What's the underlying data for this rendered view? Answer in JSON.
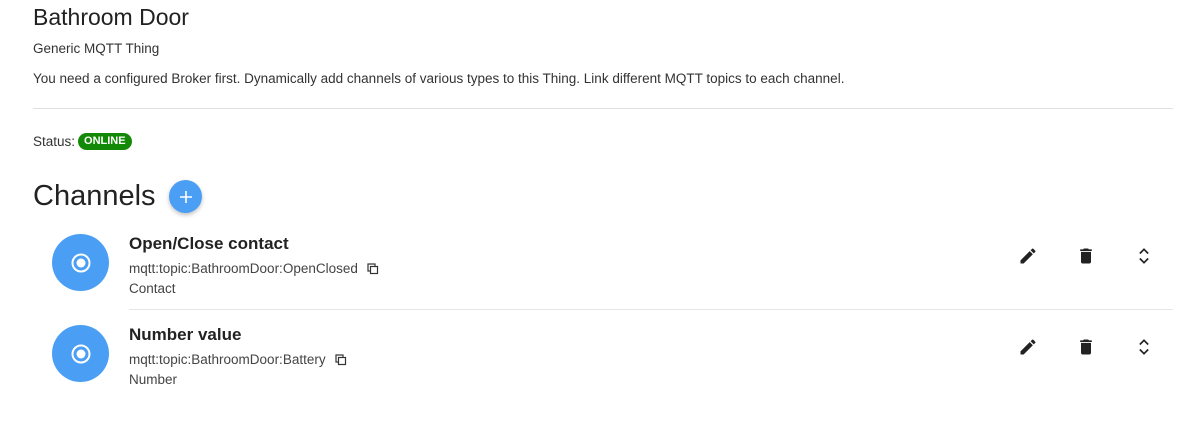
{
  "thing": {
    "title": "Bathroom Door",
    "type": "Generic MQTT Thing",
    "description": "You need a configured Broker first. Dynamically add channels of various types to this Thing. Link different MQTT topics to each channel."
  },
  "status": {
    "label": "Status:",
    "value": "ONLINE",
    "color": "#138a07"
  },
  "channels": {
    "title": "Channels",
    "add_icon": "plus-icon",
    "accent": "#4a9ff5",
    "items": [
      {
        "label": "Open/Close contact",
        "uid": "mqtt:topic:BathroomDoor:OpenClosed",
        "type": "Contact",
        "icon": "radio-button-icon"
      },
      {
        "label": "Number value",
        "uid": "mqtt:topic:BathroomDoor:Battery",
        "type": "Number",
        "icon": "radio-button-icon"
      }
    ]
  }
}
